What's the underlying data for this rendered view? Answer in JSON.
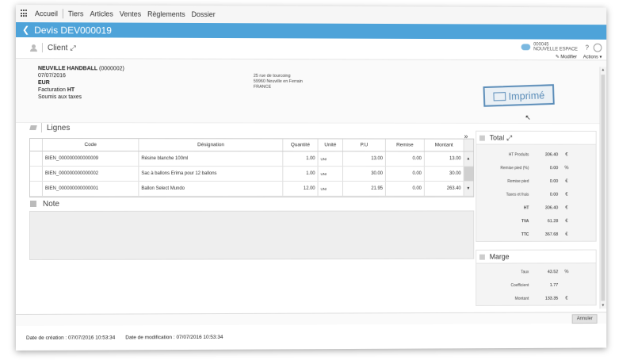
{
  "nav": {
    "home": "Accueil",
    "items": [
      "Tiers",
      "Articles",
      "Ventes",
      "Règlements",
      "Dossier"
    ]
  },
  "header": {
    "title": "Devis DEV000019"
  },
  "client_section": {
    "title": "Client"
  },
  "user": {
    "id": "000045",
    "company": "NOUVELLE ESPACE",
    "help": "?"
  },
  "actions": {
    "modify": "Modifier",
    "actions": "Actions"
  },
  "client": {
    "name": "NEUVILLE HANDBALL",
    "code": "(0000002)",
    "date": "07/07/2016",
    "currency": "EUR",
    "billing_prefix": "Facturation",
    "billing_type": "HT",
    "tax": "Soumis aux taxes",
    "address": [
      "25 rue de tourcoing",
      "59960 Neuville en Ferrain",
      "FRANCE"
    ]
  },
  "stamp": {
    "text": "Imprimé"
  },
  "lignes": {
    "title": "Lignes",
    "columns": [
      "Code",
      "Désignation",
      "Quantité",
      "Unité",
      "P.U",
      "Remise",
      "Montant"
    ],
    "rows": [
      {
        "code": "BIEN_000000000000009",
        "designation": "Résine blanche 100ml",
        "qty": "1.00",
        "unit": "UNI",
        "pu": "13.00",
        "remise": "0.00",
        "montant": "13.00"
      },
      {
        "code": "BIEN_000000000000002",
        "designation": "Sac à ballons Erima pour 12 ballons",
        "qty": "1.00",
        "unit": "UNI",
        "pu": "30.00",
        "remise": "0.00",
        "montant": "30.00"
      },
      {
        "code": "BIEN_000000000000001",
        "designation": "Ballon Select Mundo",
        "qty": "12.00",
        "unit": "UNI",
        "pu": "21.95",
        "remise": "0.00",
        "montant": "263.40"
      }
    ]
  },
  "note": {
    "title": "Note"
  },
  "total": {
    "title": "Total",
    "rows": [
      {
        "label": "HT Produits",
        "value": "306.40",
        "unit": "€"
      },
      {
        "label": "Remise pied (%)",
        "value": "0.00",
        "unit": "%"
      },
      {
        "label": "Remise pied",
        "value": "0.00",
        "unit": "€"
      },
      {
        "label": "Taxes et frais",
        "value": "0.00",
        "unit": "€"
      },
      {
        "label": "HT",
        "value": "306.40",
        "unit": "€"
      },
      {
        "label": "TVA",
        "value": "61.28",
        "unit": "€"
      },
      {
        "label": "TTC",
        "value": "367.68",
        "unit": "€"
      }
    ]
  },
  "marge": {
    "title": "Marge",
    "rows": [
      {
        "label": "Taux",
        "value": "43.52",
        "unit": "%"
      },
      {
        "label": "Coefficient",
        "value": "1.77",
        "unit": ""
      },
      {
        "label": "Montant",
        "value": "133.35",
        "unit": "€"
      }
    ]
  },
  "buttons": {
    "cancel": "Annuler"
  },
  "footer": {
    "created": "Date de création : 07/07/2016 10:53:34",
    "modified": "Date de modification : 07/07/2016 10:53:34"
  }
}
